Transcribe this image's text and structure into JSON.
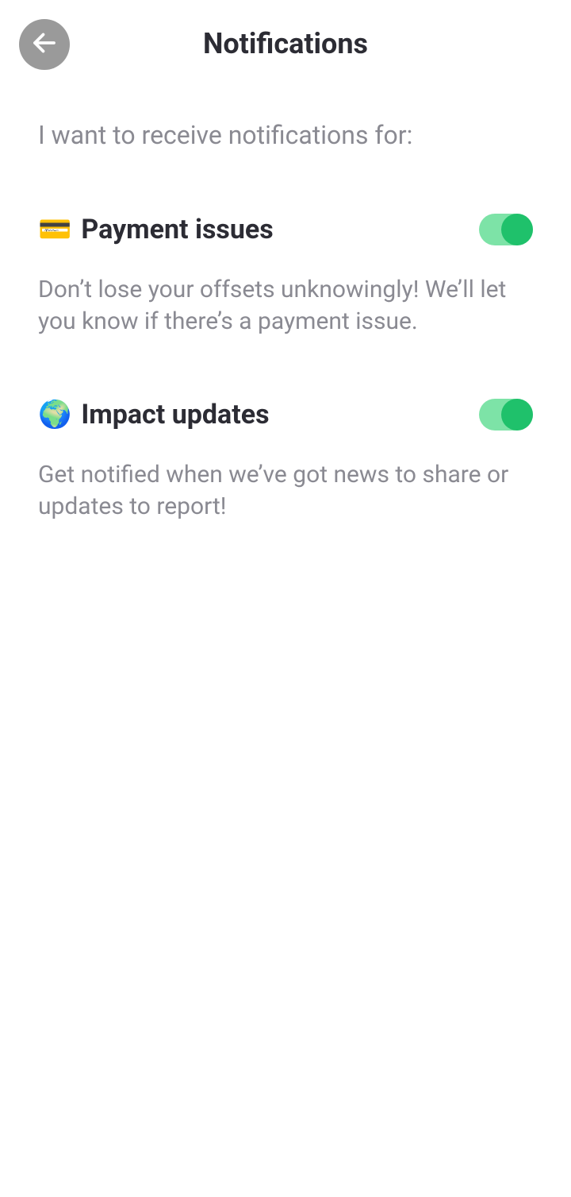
{
  "header": {
    "title": "Notifications"
  },
  "intro": "I want to receive notifications for:",
  "settings": [
    {
      "emoji": "💳",
      "title": "Payment issues",
      "description": "Don’t lose your offsets unknowingly! We’ll let you know if there’s a payment issue.",
      "enabled": true
    },
    {
      "emoji": "🌍",
      "title": "Impact updates",
      "description": "Get notified when we’ve got news to share or updates to report!",
      "enabled": true
    }
  ]
}
